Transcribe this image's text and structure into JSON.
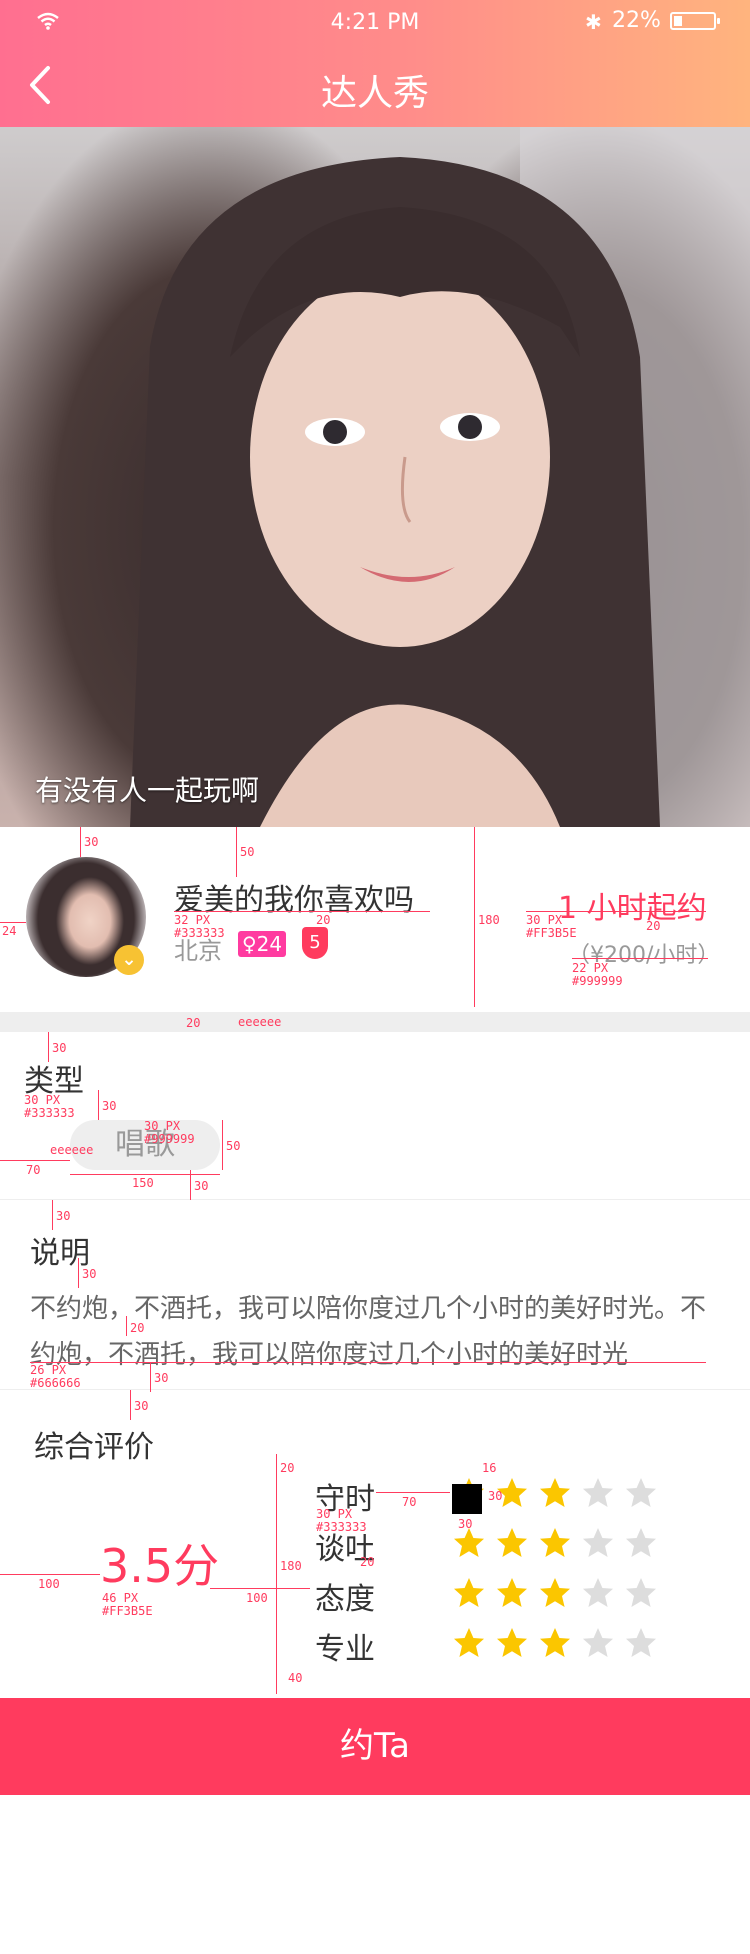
{
  "status_bar": {
    "time": "4:21 PM",
    "battery_pct": "22%",
    "battery_level": 0.22
  },
  "nav": {
    "title": "达人秀"
  },
  "cover": {
    "caption": "有没有人一起玩啊"
  },
  "profile": {
    "nickname": "爱美的我你喜欢吗",
    "city": "北京",
    "gender_age": "♀24",
    "level": "5",
    "start_hours": "1 小时起约",
    "price": "（¥200/小时）"
  },
  "type_section": {
    "title": "类型",
    "tag": "唱歌"
  },
  "desc_section": {
    "title": "说明",
    "text": "不约炮，不酒托，我可以陪你度过几个小时的美好时光。不约炮，不酒托，我可以陪你度过几个小时的美好时光"
  },
  "rating_section": {
    "title": "综合评价",
    "score": "3.5分",
    "criteria": [
      {
        "label": "守时",
        "stars": 3
      },
      {
        "label": "谈吐",
        "stars": 3
      },
      {
        "label": "态度",
        "stars": 3
      },
      {
        "label": "专业",
        "stars": 3
      }
    ],
    "max_stars": 5
  },
  "cta": {
    "label": "约Ta"
  },
  "colors": {
    "accent": "#ff3b5e",
    "text_dark": "#333333",
    "text_gray": "#999999",
    "text_desc": "#666666",
    "divider": "#eeeeee",
    "star_on": "#fbc600",
    "star_off": "#dddddd"
  },
  "annotations": {
    "a30_top": "30",
    "a50": "50",
    "a180": "180",
    "a24": "24",
    "nick_spec": "32 PX\n#333333",
    "a20_nick": "20",
    "start_spec": "30 PX\n#FF3B5E",
    "a20_price": "20",
    "price_spec": "22 PX\n#999999",
    "a20_gap": "20",
    "gap_color": "eeeeee",
    "a30_type": "30",
    "type_spec": "30 PX\n#333333",
    "a30_tag": "30",
    "tag_spec": "30 PX\n#999999",
    "tag_bg": "eeeeee",
    "a50_tag": "50",
    "a70": "70",
    "a150": "150",
    "a30_tagb": "30",
    "a30_desc": "30",
    "a30_desc2": "30",
    "a20_desc": "20",
    "desc_spec": "26 PX\n#666666",
    "a30_desc3": "30",
    "a30_rate": "30",
    "a20_rate": "20",
    "a16": "16",
    "a70_crit": "70",
    "a30_star": "30",
    "a30_star2": "30",
    "crit_spec": "30 PX\n#333333",
    "a20_crit": "20",
    "a100_left": "100",
    "a180_rate": "180",
    "a100_mid": "100",
    "score_spec": "46 PX\n#FF3B5E",
    "a40": "40"
  }
}
